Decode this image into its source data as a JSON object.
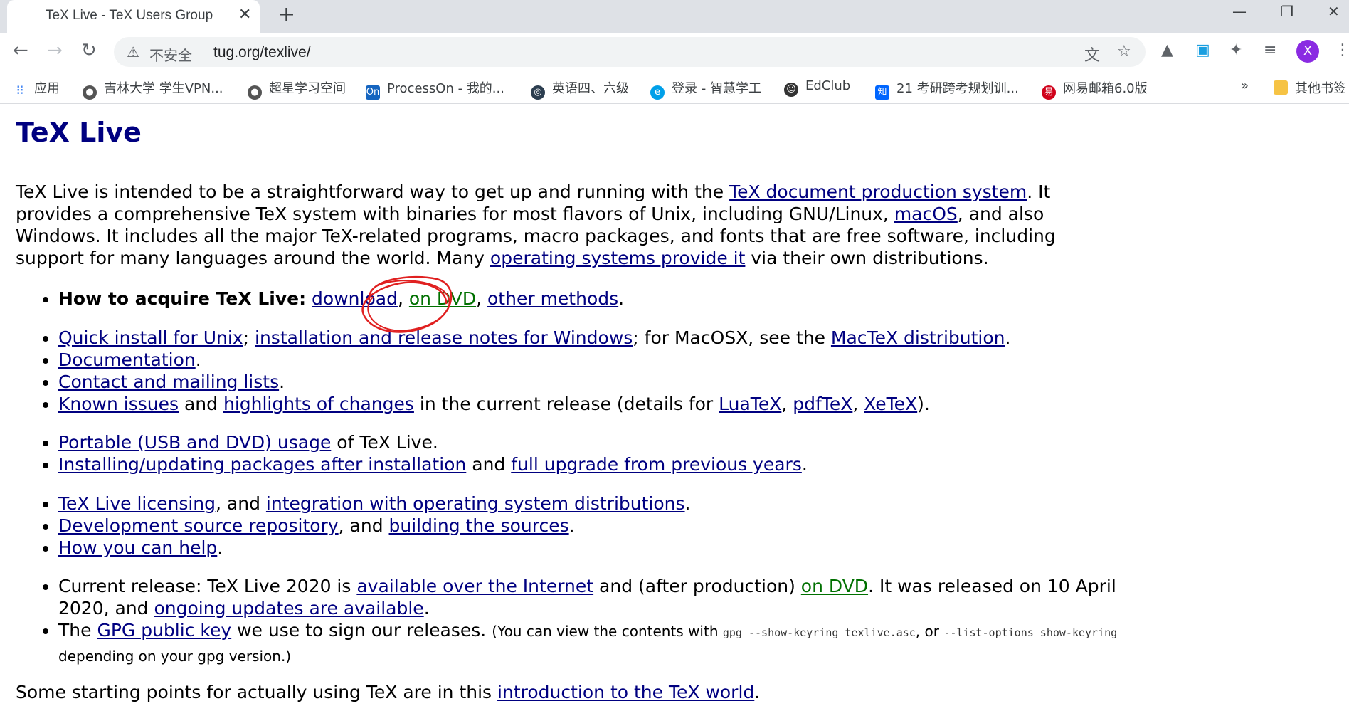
{
  "browser": {
    "tab_title": "TeX Live - TeX Users Group",
    "tab_close": "✕",
    "new_tab": "+",
    "url": "tug.org/texlive/",
    "insecure_label": "不安全",
    "avatar_letter": "X",
    "bookmarks": [
      {
        "label": "应用",
        "color": "#4285f4"
      },
      {
        "label": "吉林大学 学生VPN...",
        "color": "#555555"
      },
      {
        "label": "超星学习空间",
        "color": "#555555"
      },
      {
        "label": "ProcessOn - 我的...",
        "color": "#1565c0"
      },
      {
        "label": "英语四、六级",
        "color": "#2c3e50"
      },
      {
        "label": "登录 - 智慧学工",
        "color": "#00a0e9"
      },
      {
        "label": "EdClub",
        "color": "#333333"
      },
      {
        "label": "21 考研跨考规划训...",
        "color": "#0066ff"
      },
      {
        "label": "网易邮箱6.0版",
        "color": "#d0021b"
      }
    ],
    "more_bookmarks": "»",
    "other_bookmarks": "其他书签"
  },
  "page": {
    "title": "TeX Live",
    "intro": {
      "t1": "TeX Live is intended to be a straightforward way to get up and running with the ",
      "link1": "TeX document production system",
      "t2": ". It provides a comprehensive TeX system with binaries for most flavors of Unix, including GNU/Linux, ",
      "link2": "macOS",
      "t3": ", and also Windows. It includes all the major TeX-related programs, macro packages, and fonts that are free software, including support for many languages around the world. Many ",
      "link3": "operating systems provide it",
      "t4": " via their own distributions."
    },
    "acquire": {
      "label": "How to acquire TeX Live:",
      "download": "download",
      "dvd": "on DVD",
      "other": "other methods"
    },
    "list2": {
      "quick_install": "Quick install for Unix",
      "windows_notes": "installation and release notes for Windows",
      "macosx_text": "; for MacOSX, see the ",
      "mactex": "MacTeX distribution",
      "documentation": "Documentation",
      "contact": "Contact and mailing lists",
      "known_issues": "Known issues",
      "and": " and ",
      "highlights": "highlights of changes",
      "current_release_text": " in the current release (details for ",
      "luatex": "LuaTeX",
      "pdftex": "pdfTeX",
      "xetex": "XeTeX"
    },
    "list3": {
      "portable": "Portable (USB and DVD) usage",
      "of_texlive": " of TeX Live.",
      "installing": "Installing/updating packages after installation",
      "upgrade": "full upgrade from previous years"
    },
    "list4": {
      "licensing": "TeX Live licensing",
      "and_comma": ", and ",
      "integration": "integration with operating system distributions",
      "dev_repo": "Development source repository",
      "building": "building the sources",
      "help": "How you can help"
    },
    "list5": {
      "current_text": "Current release: TeX Live 2020 is ",
      "available": "available over the Internet",
      "after_prod": " and (after production) ",
      "on_dvd": "on DVD",
      "released_text": ". It was released on 10 April 2020, and ",
      "ongoing": "ongoing updates are available",
      "the": "The ",
      "gpg": "GPG public key",
      "sign_text": " we use to sign our releases. ",
      "view_text": "(You can view the contents with ",
      "cmd1": "gpg  --show-keyring  texlive.asc",
      "or": ", or ",
      "cmd2": "--list-options  show-keyring",
      "depending": "depending on your gpg version.)"
    },
    "closing": {
      "text": "Some starting points for actually using TeX are in this ",
      "link": "introduction to the TeX world"
    }
  }
}
